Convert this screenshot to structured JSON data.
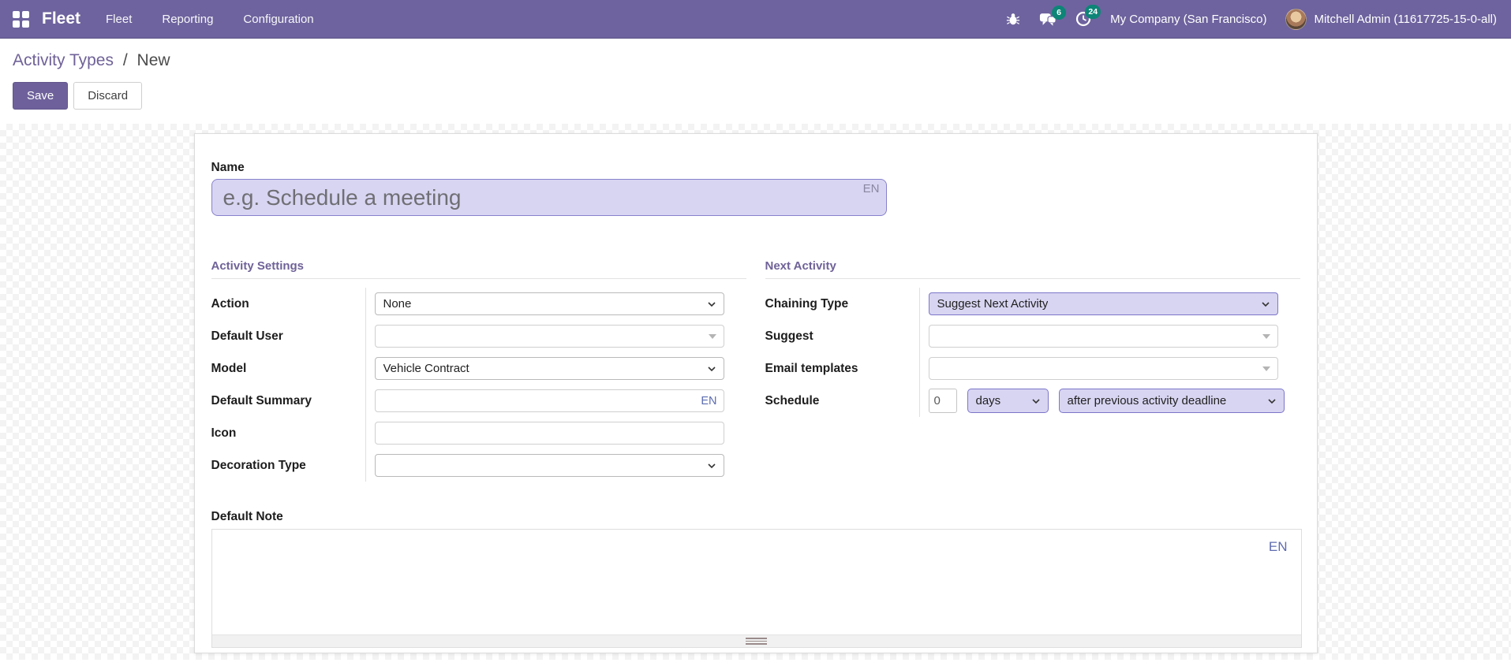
{
  "navbar": {
    "brand": "Fleet",
    "menus": [
      "Fleet",
      "Reporting",
      "Configuration"
    ],
    "messages_count": "6",
    "activities_count": "24",
    "company": "My Company (San Francisco)",
    "user": "Mitchell Admin (11617725-15-0-all)"
  },
  "breadcrumb": {
    "parent": "Activity Types",
    "separator": "/",
    "current": "New"
  },
  "actions": {
    "save": "Save",
    "discard": "Discard"
  },
  "form": {
    "name": {
      "label": "Name",
      "placeholder": "e.g. Schedule a meeting",
      "value": "",
      "lang_badge": "EN"
    },
    "sections": {
      "activity_settings": {
        "title": "Activity Settings"
      },
      "next_activity": {
        "title": "Next Activity"
      }
    },
    "fields": {
      "action": {
        "label": "Action",
        "value": "None"
      },
      "default_user": {
        "label": "Default User",
        "value": ""
      },
      "model": {
        "label": "Model",
        "value": "Vehicle Contract"
      },
      "default_summary": {
        "label": "Default Summary",
        "value": "",
        "lang_badge": "EN"
      },
      "icon": {
        "label": "Icon",
        "value": ""
      },
      "decoration_type": {
        "label": "Decoration Type",
        "value": ""
      },
      "chaining_type": {
        "label": "Chaining Type",
        "value": "Suggest Next Activity"
      },
      "suggest": {
        "label": "Suggest",
        "value": ""
      },
      "email_templates": {
        "label": "Email templates",
        "value": ""
      },
      "schedule": {
        "label": "Schedule",
        "number": "0",
        "unit": "days",
        "trigger": "after previous activity deadline"
      }
    },
    "default_note": {
      "label": "Default Note",
      "value": "",
      "lang_badge": "EN"
    }
  },
  "colors": {
    "navbar": "#6e639e",
    "badge": "#0d8577",
    "accent_lavender": "#d8d5f2"
  }
}
